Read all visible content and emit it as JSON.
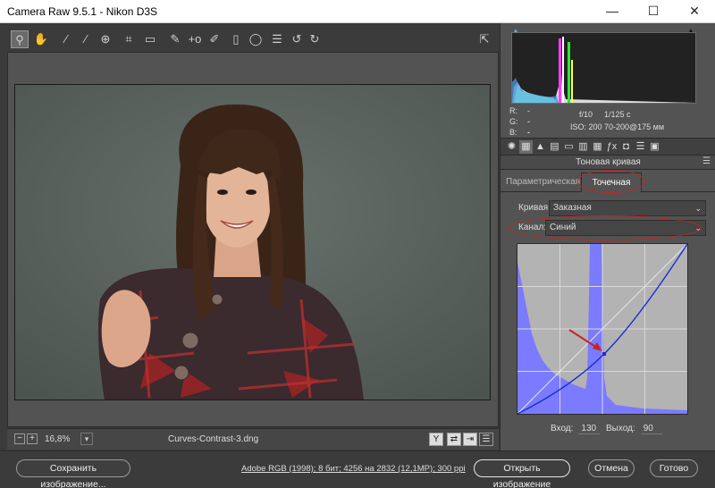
{
  "window": {
    "title": "Camera Raw 9.5.1  -  Nikon D3S",
    "min": "—",
    "max": "☐",
    "close": "✕"
  },
  "toolbar": {
    "tools": [
      "zoom-tool",
      "hand-tool",
      "white-balance-tool",
      "color-sampler-tool",
      "targeted-adjustment-tool",
      "crop-tool",
      "straighten-tool",
      "spot-removal-tool",
      "red-eye-tool",
      "adjustment-brush",
      "graduated-filter",
      "radial-filter",
      "presets-list",
      "rotate-ccw",
      "rotate-cw"
    ]
  },
  "info": {
    "r_label": "R:",
    "g_label": "G:",
    "b_label": "B:",
    "r_value": "---",
    "g_value": "---",
    "b_value": "---",
    "aperture": "f/10",
    "shutter": "1/125 с",
    "iso": "ISO: 200",
    "lens": "70-200@175 мм"
  },
  "panel": {
    "title": "Тоновая кривая",
    "tabs": {
      "parametric": "Параметрическая",
      "point": "Точечная"
    },
    "curve_label": "Кривая:",
    "curve_value": "Заказная",
    "channel_label": "Канал:",
    "channel_value": "Синий",
    "input_label": "Вход:",
    "input_value": "130",
    "output_label": "Выход:",
    "output_value": "90",
    "point": {
      "input": 130,
      "output": 90
    }
  },
  "status": {
    "zoom": "16,8%",
    "filename": "Curves-Contrast-3.dng"
  },
  "footer": {
    "save": "Сохранить изображение...",
    "info": "Adobe RGB (1998); 8 бит; 4256 на 2832 (12,1MP); 300 ppi",
    "open": "Открыть изображение",
    "cancel": "Отмена",
    "done": "Готово"
  },
  "colors": {
    "highlight_ring": "#c52424",
    "curve_blue": "#1b2bd6",
    "histogram_blue": "#7373ff"
  }
}
